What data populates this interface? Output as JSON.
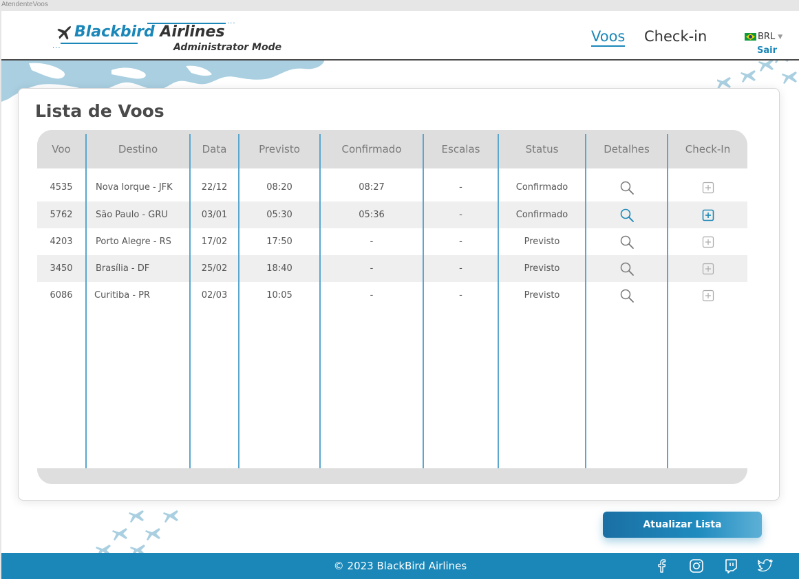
{
  "window": {
    "title": "AtendenteVoos"
  },
  "brand": {
    "name_part1": "Blackbird",
    "name_part2": " Airlines",
    "subtitle": "Administrator Mode",
    "accent": "#1a87b8"
  },
  "nav": {
    "items": [
      {
        "label": "Voos",
        "active": true
      },
      {
        "label": "Check-in",
        "active": false
      }
    ],
    "currency": "BRL",
    "currency_icon": "brazil-flag-icon",
    "logout": "Sair"
  },
  "main": {
    "title": "Lista de Voos",
    "table": {
      "columns": [
        "Voo",
        "Destino",
        "Data",
        "Previsto",
        "Confirmado",
        "Escalas",
        "Status",
        "Detalhes",
        "Check-In"
      ],
      "rows": [
        {
          "voo": "4535",
          "destino": "Nova Iorque - JFK",
          "data": "22/12",
          "previsto": "08:20",
          "confirmado": "08:27",
          "escalas": "-",
          "status": "Confirmado",
          "detalhes_icon": "search-icon",
          "checkin_icon": "plus-square-icon",
          "highlighted": false
        },
        {
          "voo": "5762",
          "destino": "São Paulo - GRU",
          "data": "03/01",
          "previsto": "05:30",
          "confirmado": "05:36",
          "escalas": "-",
          "status": "Confirmado",
          "detalhes_icon": "search-icon",
          "checkin_icon": "plus-square-icon",
          "highlighted": true
        },
        {
          "voo": "4203",
          "destino": "Porto Alegre - RS",
          "data": "17/02",
          "previsto": "17:50",
          "confirmado": "-",
          "escalas": "-",
          "status": "Previsto",
          "detalhes_icon": "search-icon",
          "checkin_icon": "plus-square-icon",
          "highlighted": false
        },
        {
          "voo": "3450",
          "destino": "Brasília - DF",
          "data": "25/02",
          "previsto": "18:40",
          "confirmado": "-",
          "escalas": "-",
          "status": "Previsto",
          "detalhes_icon": "search-icon",
          "checkin_icon": "plus-square-icon",
          "highlighted": false
        },
        {
          "voo": "6086",
          "destino": "Curitiba - PR",
          "data": "02/03",
          "previsto": "10:05",
          "confirmado": "-",
          "escalas": "-",
          "status": "Previsto",
          "detalhes_icon": "search-icon",
          "checkin_icon": "plus-square-icon",
          "highlighted": false
        }
      ]
    },
    "refresh_button": "Atualizar Lista"
  },
  "footer": {
    "copyright": "© 2023 BlackBird Airlines",
    "social_icons": [
      "facebook-icon",
      "instagram-icon",
      "twitch-icon",
      "twitter-icon"
    ]
  },
  "colors": {
    "primary": "#1a87b8",
    "text": "#4a4a4a",
    "muted": "#7a7a7a",
    "row_alt": "#efefef",
    "header_bg": "#dedede"
  }
}
